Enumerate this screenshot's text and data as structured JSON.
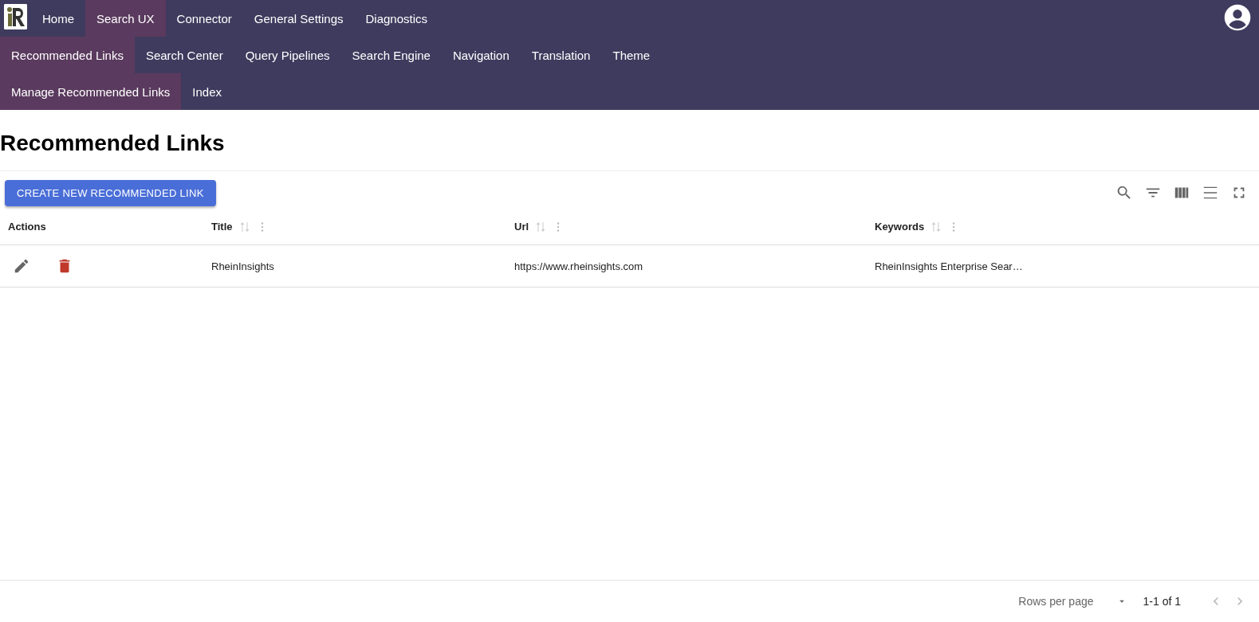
{
  "nav_levels": [
    [
      {
        "label": "Home",
        "selected": false
      },
      {
        "label": "Search UX",
        "selected": true
      },
      {
        "label": "Connector",
        "selected": false
      },
      {
        "label": "General Settings",
        "selected": false
      },
      {
        "label": "Diagnostics",
        "selected": false
      }
    ],
    [
      {
        "label": "Recommended Links",
        "selected": true
      },
      {
        "label": "Search Center",
        "selected": false
      },
      {
        "label": "Query Pipelines",
        "selected": false
      },
      {
        "label": "Search Engine",
        "selected": false
      },
      {
        "label": "Navigation",
        "selected": false
      },
      {
        "label": "Translation",
        "selected": false
      },
      {
        "label": "Theme",
        "selected": false
      }
    ],
    [
      {
        "label": "Manage Recommended Links",
        "selected": true
      },
      {
        "label": "Index",
        "selected": false
      }
    ]
  ],
  "page_title": "Recommended Links",
  "create_button": "CREATE NEW RECOMMENDED LINK",
  "table": {
    "columns": [
      {
        "label": "Actions",
        "sortable": false
      },
      {
        "label": "Title",
        "sortable": true
      },
      {
        "label": "Url",
        "sortable": true
      },
      {
        "label": "Keywords",
        "sortable": true
      }
    ],
    "rows": [
      {
        "title": "RheinInsights",
        "url": "https://www.rheinsights.com",
        "keywords": "RheinInsights Enterprise Sear…"
      }
    ]
  },
  "pagination": {
    "rows_per_page_label": "Rows per page",
    "range": "1-1 of 1"
  }
}
